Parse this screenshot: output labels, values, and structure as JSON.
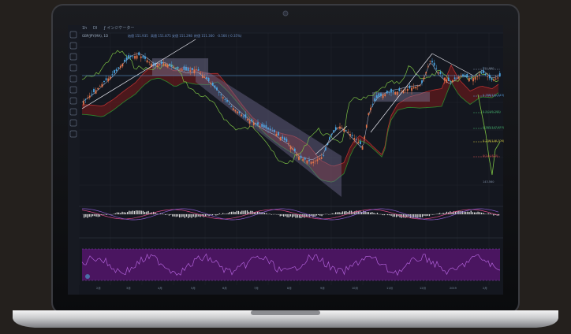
{
  "toolbar": {
    "timeframe": "1h",
    "chart_style": "Dl",
    "indicators_button": "インジケーター"
  },
  "legend": {
    "symbol": "GBP/JPY(MA), 1D",
    "open": "始値 151.935",
    "high": "高値 151.875",
    "low": "安値 151.298",
    "close": "終値 151.360",
    "change": "-0.566 (-0.35%)"
  },
  "price_labels": [
    {
      "text": "151.660",
      "color": "#7f8ea3"
    },
    {
      "text": "0.786(151.343)",
      "color": "#5aa0e0"
    },
    {
      "text": "0.5(149.200)",
      "color": "#48b870"
    },
    {
      "text": "0.382(147.953)",
      "color": "#48b870"
    },
    {
      "text": "0.236(146.706)",
      "color": "#c9c040"
    },
    {
      "text": "0(144.820)",
      "color": "#d85050"
    },
    {
      "text": "143.560",
      "color": "#7f8ea3"
    }
  ],
  "time_ticks": [
    "2月",
    "3月",
    "4月",
    "5月",
    "6月",
    "7月",
    "8月",
    "9月",
    "10月",
    "11月",
    "12月",
    "2019",
    "2月"
  ],
  "colors": {
    "bezel": "#0b0c0e",
    "chart_bg": "#14171f",
    "bull_candle": "#e0744a",
    "bear_candle": "#4aa3e0",
    "cloud_red": "#8a1c1c",
    "cloud_green": "#1d5a1d",
    "rsi_band": "#4a1560"
  },
  "icons": [
    "cursor-icon",
    "trendline-icon",
    "fibonacci-icon",
    "brush-icon",
    "text-icon",
    "pattern-icon",
    "measure-icon",
    "zoom-icon",
    "magnet-icon",
    "trash-icon"
  ]
}
